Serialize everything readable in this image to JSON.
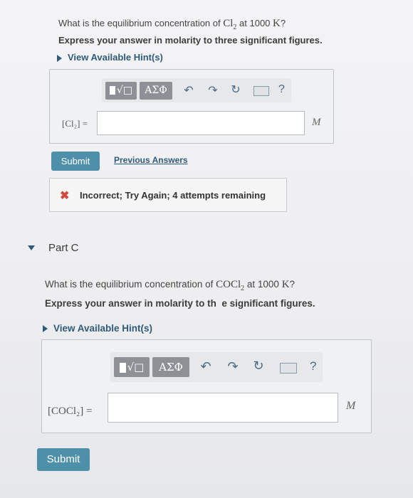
{
  "partB": {
    "question_prefix": "What is the equilibrium concentration of ",
    "question_chem": "Cl",
    "question_chem_sub": "2",
    "question_mid": " at 1000 ",
    "question_unit": "K",
    "question_suffix": "?",
    "instruction": "Express your answer in molarity to three significant figures.",
    "hint": "View Available Hint(s)",
    "toolbar": {
      "template": "√□",
      "greek": "ΑΣΦ",
      "help": "?"
    },
    "answer_label": "[Cl₂] =",
    "answer_value": "",
    "unit": "M",
    "submit": "Submit",
    "previous_answers": "Previous Answers",
    "feedback": "Incorrect; Try Again; 4 attempts remaining",
    "feedback_icon": "✖"
  },
  "partC": {
    "heading": "Part C",
    "question_prefix": "What is the equilibrium concentration of ",
    "question_chem": "COCl",
    "question_chem_sub": "2",
    "question_mid": " at 1000 ",
    "question_unit": "K",
    "question_suffix": "?",
    "instruction": "Express your answer in molarity to th  e significant figures.",
    "hint": "View Available Hint(s)",
    "toolbar": {
      "template": "√□",
      "greek": "ΑΣΦ",
      "help": "?"
    },
    "answer_label": "[COCl₂] =",
    "answer_value": "",
    "unit": "M",
    "submit": "Submit"
  },
  "colors": {
    "accent": "#4e8fa9",
    "link": "#2f5a78",
    "error": "#d04a3e"
  }
}
